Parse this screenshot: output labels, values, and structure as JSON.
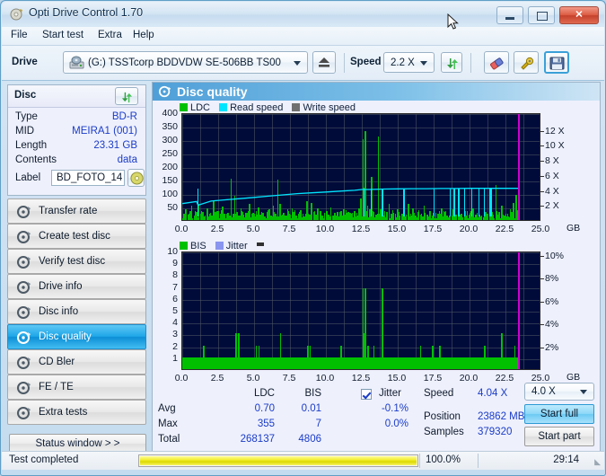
{
  "window": {
    "title": "Opti Drive Control 1.70",
    "title_icon": "disc-icon",
    "minimize_label": "—",
    "maximize_label": "□",
    "close_label": "✕"
  },
  "menubar": {
    "items": [
      {
        "label": "File",
        "accel": "F"
      },
      {
        "label": "Start test",
        "accel": "S"
      },
      {
        "label": "Extra",
        "accel": "x"
      },
      {
        "label": "Help",
        "accel": "H"
      }
    ]
  },
  "toolbar": {
    "drive_label": "Drive",
    "drive_value": "(G:)  TSSTcorp BDDVDW SE-506BB TS00",
    "eject_icon": "eject-icon",
    "speed_label": "Speed",
    "speed_value": "2.2 X",
    "refresh_icon": "refresh-icon",
    "erase_icon": "eraser-icon",
    "tools_icon": "tools-icon",
    "save_icon": "save-icon"
  },
  "disc_panel": {
    "header": "Disc",
    "refresh_icon": "refresh-icon",
    "rows": [
      {
        "key": "Type",
        "value": "BD-R"
      },
      {
        "key": "MID",
        "value": "MEIRA1 (001)"
      },
      {
        "key": "Length",
        "value": "23.31 GB"
      },
      {
        "key": "Contents",
        "value": "data"
      }
    ],
    "label_key": "Label",
    "label_value": "BD_FOTO_14",
    "disc_icon": "cd-disc-icon"
  },
  "nav": {
    "items": [
      {
        "label": "Transfer rate",
        "icon": "disc-icon",
        "active": false
      },
      {
        "label": "Create test disc",
        "icon": "disc-icon",
        "active": false
      },
      {
        "label": "Verify test disc",
        "icon": "disc-icon",
        "active": false
      },
      {
        "label": "Drive info",
        "icon": "disc-icon",
        "active": false
      },
      {
        "label": "Disc info",
        "icon": "disc-icon",
        "active": false
      },
      {
        "label": "Disc quality",
        "icon": "disc-icon",
        "active": true
      },
      {
        "label": "CD Bler",
        "icon": "disc-icon",
        "active": false
      },
      {
        "label": "FE / TE",
        "icon": "disc-icon",
        "active": false
      },
      {
        "label": "Extra tests",
        "icon": "disc-icon",
        "active": false
      }
    ],
    "status_window_button": "Status window > >"
  },
  "main": {
    "title": "Disc quality",
    "title_icon": "disc-quality-icon"
  },
  "stats": {
    "col_headers": [
      "LDC",
      "BIS"
    ],
    "jitter_label": "Jitter",
    "jitter_checked": true,
    "rows": [
      {
        "name": "Avg",
        "ldc": "0.70",
        "bis": "0.01",
        "jitter": "-0.1%"
      },
      {
        "name": "Max",
        "ldc": "355",
        "bis": "7",
        "jitter": "0.0%"
      },
      {
        "name": "Total",
        "ldc": "268137",
        "bis": "4806",
        "jitter": ""
      }
    ],
    "speed_label": "Speed",
    "speed_value": "4.04 X",
    "position_label": "Position",
    "position_value": "23862 MB",
    "samples_label": "Samples",
    "samples_value": "379320",
    "speed_select": "4.0 X",
    "start_full": "Start full",
    "start_part": "Start part"
  },
  "statusbar": {
    "message": "Test completed",
    "percent": "100.0%",
    "progress_value": 100,
    "elapsed": "29:14"
  },
  "colors": {
    "ldc_green": "#00c000",
    "read_speed_cyan": "#00e5ff",
    "write_speed_gray": "#707070",
    "bis_green": "#00c000",
    "jitter_blue": "#8a95ef",
    "plot_bg": "#000b3a",
    "accent_blue": "#1a3cc8",
    "progress_yellow": "#e8e400"
  },
  "chart_data": [
    {
      "type": "bar",
      "name": "quality-chart-ldc",
      "title": "",
      "legend": [
        {
          "label": "LDC",
          "color": "#00c000"
        },
        {
          "label": "Read speed",
          "color": "#00e5ff"
        },
        {
          "label": "Write speed",
          "color": "#707070"
        }
      ],
      "legend_position": "top-left",
      "grid": true,
      "xlabel": "GB",
      "ylabel": "LDC",
      "y2label": "X",
      "xlim": [
        0,
        25.0
      ],
      "ylim": [
        0,
        400
      ],
      "y2lim": [
        0,
        13
      ],
      "xticks": [
        "0.0",
        "2.5",
        "5.0",
        "7.5",
        "10.0",
        "12.5",
        "15.0",
        "17.5",
        "20.0",
        "22.5",
        "25.0"
      ],
      "yticks": [
        50,
        100,
        150,
        200,
        250,
        300,
        350,
        400
      ],
      "y2ticks": [
        "2 X",
        "4 X",
        "6 X",
        "8 X",
        "10 X",
        "12 X"
      ],
      "series": [
        {
          "name": "LDC",
          "color": "#00c000",
          "type": "bar",
          "x": [
            0.05,
            0.2,
            0.35,
            0.5,
            0.62,
            0.8,
            0.95,
            1.1,
            1.25,
            1.4,
            1.55,
            1.7,
            1.85,
            2.0,
            2.15,
            2.3,
            2.45,
            2.6,
            2.75,
            2.9,
            3.05,
            3.2,
            3.35,
            3.5,
            3.62,
            3.75,
            3.9,
            4.05,
            4.2,
            4.35,
            4.5,
            4.65,
            4.8,
            4.95,
            5.1,
            5.25,
            5.4,
            5.55,
            5.7,
            5.85,
            6.0,
            6.15,
            6.3,
            6.45,
            6.6,
            6.75,
            6.85,
            7.0,
            7.15,
            7.3,
            7.45,
            7.6,
            7.75,
            7.9,
            8.05,
            8.2,
            8.35,
            8.5,
            8.65,
            8.8,
            8.95,
            9.1,
            9.25,
            9.4,
            9.55,
            9.7,
            9.85,
            10.0,
            10.15,
            10.3,
            10.45,
            10.6,
            10.75,
            10.9,
            11.05,
            11.2,
            11.35,
            11.5,
            11.65,
            11.8,
            11.95,
            12.1,
            12.25,
            12.4,
            12.55,
            12.62,
            12.7,
            12.85,
            13.0,
            13.15,
            13.3,
            13.45,
            13.6,
            13.75,
            13.9,
            14.05,
            14.2,
            14.35,
            14.5,
            14.65,
            14.8,
            14.95,
            15.1,
            15.25,
            15.4,
            15.55,
            15.7,
            15.85,
            16.0,
            16.2,
            16.4,
            16.6,
            16.8,
            17.0,
            17.2,
            17.4,
            17.6,
            17.8,
            18.0,
            18.2,
            18.4,
            18.6,
            18.8,
            19.0,
            19.2,
            19.4,
            19.6,
            19.8,
            20.0,
            20.2,
            20.4,
            20.6,
            20.8,
            21.0,
            21.2,
            21.4,
            21.6,
            21.8,
            22.0,
            22.2,
            22.4,
            22.6,
            22.8,
            23.0,
            23.2
          ],
          "values": [
            15,
            40,
            20,
            12,
            55,
            18,
            25,
            60,
            14,
            30,
            18,
            45,
            22,
            16,
            70,
            20,
            35,
            18,
            50,
            25,
            14,
            18,
            155,
            22,
            90,
            30,
            16,
            45,
            20,
            28,
            18,
            60,
            22,
            16,
            35,
            48,
            20,
            26,
            14,
            30,
            40,
            18,
            55,
            22,
            150,
            60,
            18,
            28,
            16,
            40,
            20,
            45,
            30,
            18,
            22,
            38,
            25,
            14,
            70,
            20,
            65,
            30,
            18,
            42,
            22,
            16,
            28,
            35,
            20,
            48,
            18,
            25,
            30,
            14,
            22,
            40,
            18,
            30,
            26,
            20,
            35,
            28,
            45,
            80,
            300,
            120,
            330,
            55,
            40,
            160,
            30,
            20,
            310,
            40,
            25,
            35,
            20,
            60,
            18,
            28,
            22,
            40,
            18,
            25,
            30,
            20,
            60,
            22,
            45,
            18,
            30,
            25,
            55,
            20,
            35,
            18,
            28,
            22,
            45,
            30,
            18,
            25,
            40,
            20,
            30,
            22,
            18,
            35,
            28,
            42,
            20,
            30,
            18,
            25,
            22,
            38,
            20,
            130,
            30,
            55,
            18,
            25,
            40,
            65,
            95
          ]
        },
        {
          "name": "Read speed",
          "color": "#00e5ff",
          "type": "line",
          "x": [
            0.0,
            1.0,
            1.1,
            2.0,
            3.0,
            4.0,
            5.0,
            6.0,
            7.0,
            8.0,
            9.0,
            10.0,
            11.0,
            12.0,
            12.5,
            13.0,
            14.0,
            15.0,
            16.0,
            17.0,
            18.0,
            19.0,
            20.0,
            21.0,
            22.0,
            23.0,
            23.4
          ],
          "values_x": [
            2.2,
            2.45,
            2.0,
            2.5,
            2.65,
            2.8,
            2.95,
            3.1,
            3.25,
            3.4,
            3.5,
            3.6,
            3.7,
            3.8,
            3.9,
            3.9,
            3.95,
            3.98,
            4.0,
            4.0,
            4.02,
            4.02,
            4.04,
            4.04,
            4.04,
            4.04,
            4.04
          ]
        },
        {
          "name": "Write speed",
          "color": "#707070",
          "type": "bar",
          "x": [],
          "values": []
        }
      ],
      "annotations": [
        {
          "type": "vline",
          "x": 23.4,
          "color": "#d000d0",
          "label": "end-of-data-marker"
        }
      ]
    },
    {
      "type": "bar",
      "name": "quality-chart-bis",
      "title": "",
      "legend": [
        {
          "label": "BIS",
          "color": "#00c000"
        },
        {
          "label": "Jitter",
          "color": "#8a95ef"
        }
      ],
      "legend_position": "top-left",
      "grid": true,
      "xlabel": "GB",
      "ylabel": "BIS",
      "y2label": "%",
      "xlim": [
        0,
        25.0
      ],
      "ylim": [
        0,
        10
      ],
      "y2lim": [
        0,
        10
      ],
      "xticks": [
        "0.0",
        "2.5",
        "5.0",
        "7.5",
        "10.0",
        "12.5",
        "15.0",
        "17.5",
        "20.0",
        "22.5",
        "25.0"
      ],
      "yticks": [
        1,
        2,
        3,
        4,
        5,
        6,
        7,
        8,
        9,
        10
      ],
      "y2ticks": [
        "2%",
        "4%",
        "6%",
        "8%",
        "10%"
      ],
      "series": [
        {
          "name": "BIS",
          "color": "#00c000",
          "type": "bar",
          "x": [
            0.05,
            0.3,
            0.6,
            0.9,
            1.2,
            1.45,
            1.7,
            1.95,
            2.2,
            2.5,
            2.8,
            3.1,
            3.4,
            3.7,
            3.8,
            3.9,
            4.2,
            4.5,
            4.8,
            5.1,
            5.3,
            5.45,
            5.7,
            6.0,
            6.2,
            6.5,
            6.8,
            6.95,
            7.2,
            7.5,
            7.8,
            8.1,
            8.4,
            8.7,
            8.85,
            9.0,
            9.2,
            9.5,
            9.8,
            10.1,
            10.4,
            10.7,
            11.0,
            11.3,
            11.6,
            11.8,
            12.0,
            12.3,
            12.55,
            12.62,
            12.7,
            12.9,
            13.1,
            13.3,
            13.6,
            13.9,
            14.05,
            14.2,
            14.5,
            14.8,
            15.1,
            15.4,
            15.7,
            16.0,
            16.3,
            16.55,
            16.8,
            17.1,
            17.4,
            17.7,
            17.9,
            18.0,
            18.3,
            18.6,
            18.9,
            19.2,
            19.5,
            19.8,
            20.1,
            20.4,
            20.7,
            21.0,
            21.3,
            21.5,
            21.6,
            21.9,
            22.2,
            22.5,
            22.6,
            22.9,
            23.1,
            23.3
          ],
          "values": [
            1,
            1,
            1,
            1,
            1,
            2,
            1,
            1,
            1,
            1,
            1,
            1,
            1,
            3,
            1,
            3,
            1,
            1,
            1,
            2,
            2,
            1,
            1,
            0,
            1,
            1,
            3,
            1,
            1,
            1,
            1,
            1,
            1,
            2,
            2,
            1,
            1,
            1,
            1,
            1,
            1,
            1,
            2,
            1,
            1,
            1,
            1,
            1,
            6.8,
            3,
            6.8,
            2,
            1,
            2,
            1,
            6.8,
            1,
            1,
            1,
            1,
            1,
            1,
            0,
            1,
            1,
            2,
            1,
            1,
            2,
            1,
            2,
            1,
            1,
            1,
            1,
            1,
            1,
            1,
            1,
            1,
            1,
            2,
            1,
            1,
            1,
            1,
            3,
            1,
            1,
            1,
            2
          ]
        },
        {
          "name": "Jitter",
          "color": "#8a95ef",
          "type": "line",
          "x": [],
          "values": []
        }
      ],
      "annotations": [
        {
          "type": "vline",
          "x": 23.4,
          "color": "#d000d0",
          "label": "end-of-data-marker"
        }
      ]
    }
  ]
}
